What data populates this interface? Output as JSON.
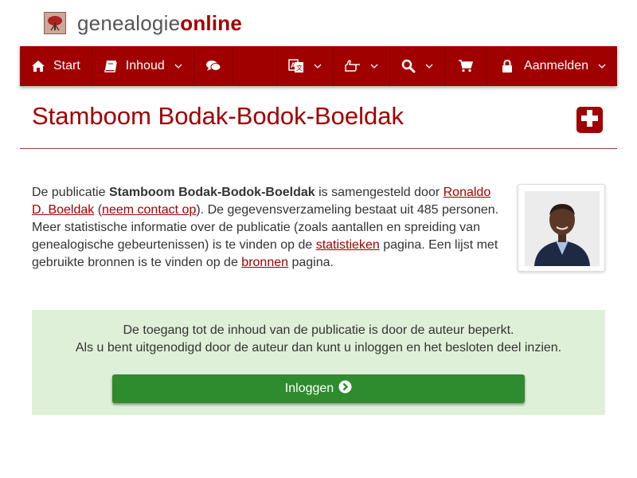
{
  "brand": {
    "part1": "genealogie",
    "part2": "online",
    "logo_icon": "tree-icon"
  },
  "nav": {
    "start": "Start",
    "inhoud": "Inhoud",
    "aanmelden": "Aanmelden"
  },
  "page": {
    "title": "Stamboom Bodak-Bodok-Boeldak"
  },
  "intro": {
    "t1": "De publicatie ",
    "pub_name": "Stamboom Bodak-Bodok-Boeldak",
    "t2": " is samengesteld door ",
    "author": "Ronaldo D. Boeldak",
    "t3": " (",
    "contact": "neem contact op",
    "t4": "). De gegevensverzameling bestaat uit 485 personen. Meer statistische informatie over de publicatie (zoals aantallen en spreiding van genealogische gebeurtenissen) is te vinden op de ",
    "stats": "statistieken",
    "t5": " pagina. Een lijst met gebruikte bronnen is te vinden op de ",
    "sources": "bronnen",
    "t6": " pagina."
  },
  "notice": {
    "line1": "De toegang tot de inhoud van de publicatie is door de auteur beperkt.",
    "line2": "Als u bent uitgenodigd door de auteur dan kunt u inloggen en het besloten deel inzien.",
    "button": "Inloggen"
  },
  "colors": {
    "brand_red": "#a00000",
    "success_green": "#2e8b2e",
    "notice_bg": "#dff0d8"
  }
}
